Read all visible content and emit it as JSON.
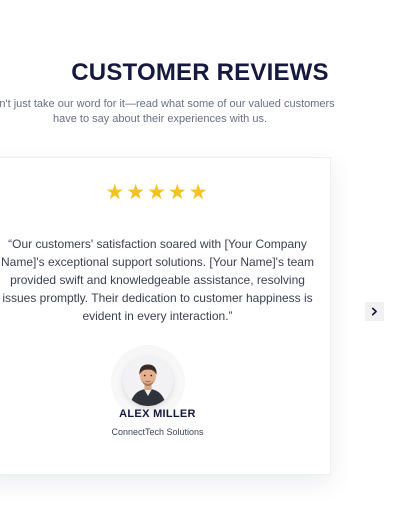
{
  "section": {
    "title": "CUSTOMER REVIEWS",
    "subtitle_lines": [
      "Don't just take our word for it—read what some of our valued customers",
      "have to say about their experiences with us."
    ]
  },
  "review": {
    "rating": 5,
    "rating_max": 5,
    "star_color": "#f6c223",
    "quote_lines": [
      "“Our customers' satisfaction soared with [Your Company",
      "Name]'s exceptional support solutions. [Your Name]'s team",
      "provided swift and knowledgeable assistance, resolving",
      "issues promptly. Their dedication to customer happiness is",
      "evident in every interaction.”"
    ],
    "author_name": "ALEX MILLER",
    "author_company": "ConnectTech Solutions"
  },
  "navigation": {
    "next_icon": "chevron-right-icon"
  },
  "colors": {
    "title": "#15183f",
    "body_text": "#3b3f52",
    "muted_text": "#6a6f86",
    "nav_button_bg": "#f1f1f4"
  }
}
